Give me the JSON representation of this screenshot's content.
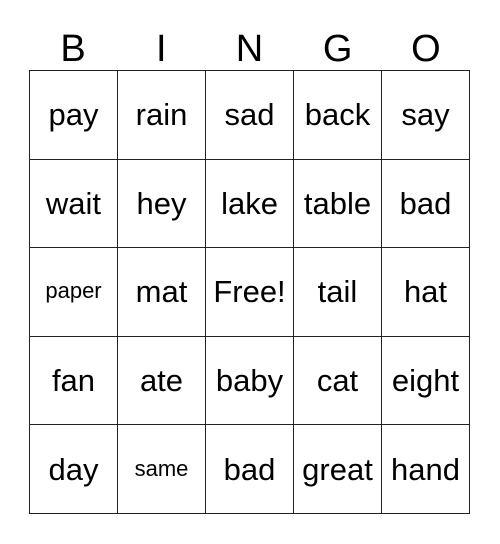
{
  "card": {
    "title": "BINGO",
    "headers": [
      "B",
      "I",
      "N",
      "G",
      "O"
    ],
    "colors": {
      "border": "#222222",
      "text": "#000000",
      "background": "#ffffff"
    },
    "rows": [
      [
        {
          "text": "pay",
          "size": "normal",
          "free": false
        },
        {
          "text": "rain",
          "size": "normal",
          "free": false
        },
        {
          "text": "sad",
          "size": "normal",
          "free": false
        },
        {
          "text": "back",
          "size": "normal",
          "free": false
        },
        {
          "text": "say",
          "size": "normal",
          "free": false
        }
      ],
      [
        {
          "text": "wait",
          "size": "normal",
          "free": false
        },
        {
          "text": "hey",
          "size": "normal",
          "free": false
        },
        {
          "text": "lake",
          "size": "normal",
          "free": false
        },
        {
          "text": "table",
          "size": "normal",
          "free": false
        },
        {
          "text": "bad",
          "size": "normal",
          "free": false
        }
      ],
      [
        {
          "text": "paper",
          "size": "small",
          "free": false
        },
        {
          "text": "mat",
          "size": "normal",
          "free": false
        },
        {
          "text": "Free!",
          "size": "normal",
          "free": true
        },
        {
          "text": "tail",
          "size": "normal",
          "free": false
        },
        {
          "text": "hat",
          "size": "normal",
          "free": false
        }
      ],
      [
        {
          "text": "fan",
          "size": "normal",
          "free": false
        },
        {
          "text": "ate",
          "size": "normal",
          "free": false
        },
        {
          "text": "baby",
          "size": "normal",
          "free": false
        },
        {
          "text": "cat",
          "size": "normal",
          "free": false
        },
        {
          "text": "eight",
          "size": "normal",
          "free": false
        }
      ],
      [
        {
          "text": "day",
          "size": "normal",
          "free": false
        },
        {
          "text": "same",
          "size": "small",
          "free": false
        },
        {
          "text": "bad",
          "size": "normal",
          "free": false
        },
        {
          "text": "great",
          "size": "normal",
          "free": false
        },
        {
          "text": "hand",
          "size": "normal",
          "free": false
        }
      ]
    ]
  }
}
